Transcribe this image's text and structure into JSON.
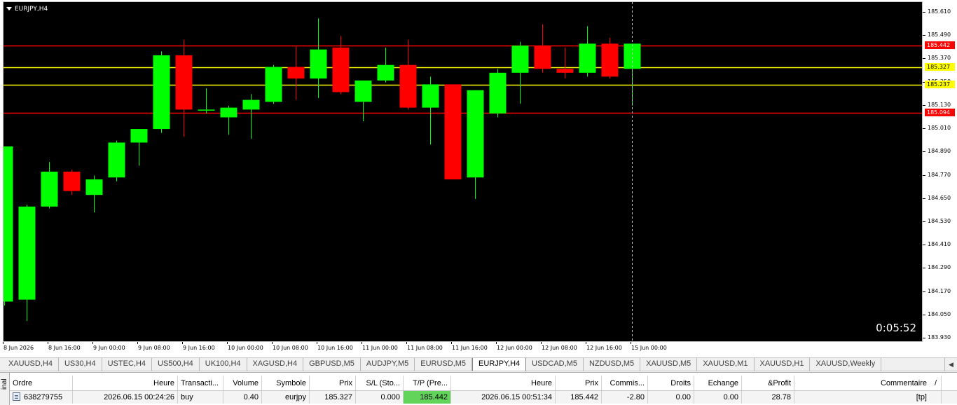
{
  "window": {
    "symbol_title": "EURJPY,H4",
    "countdown": "0:05:52"
  },
  "price_axis": {
    "ticks": [
      "185.610",
      "185.490",
      "185.370",
      "185.250",
      "185.130",
      "185.010",
      "184.890",
      "184.770",
      "184.650",
      "184.530",
      "184.410",
      "184.290",
      "184.170",
      "184.050",
      "183.930"
    ],
    "tick_values": [
      185.61,
      185.49,
      185.37,
      185.25,
      185.13,
      185.01,
      184.89,
      184.77,
      184.65,
      184.53,
      184.41,
      184.29,
      184.17,
      184.05,
      183.93
    ]
  },
  "time_axis": {
    "labels": [
      "8 Jun 2026",
      "8 Jun 16:00",
      "9 Jun 00:00",
      "9 Jun 08:00",
      "9 Jun 16:00",
      "10 Jun 00:00",
      "10 Jun 08:00",
      "10 Jun 16:00",
      "11 Jun 00:00",
      "11 Jun 08:00",
      "11 Jun 16:00",
      "12 Jun 00:00",
      "12 Jun 08:00",
      "12 Jun 16:00",
      "15 Jun 00:00"
    ]
  },
  "colors": {
    "bull": "#00ff00",
    "bear": "#ff0000",
    "tp_line": "#ff0000",
    "entry_line": "#ffff00",
    "background": "#000000"
  },
  "levels": [
    {
      "name": "take-profit-upper",
      "price": 185.442,
      "label": "185.442",
      "color": "#ff0000",
      "text_color": "#ffffff"
    },
    {
      "name": "open-price",
      "price": 185.327,
      "label": "185.327",
      "color": "#ffff00",
      "text_color": "#000000"
    },
    {
      "name": "bid-price",
      "price": 185.237,
      "label": "185.237",
      "color": "#ffff00",
      "text_color": "#000000"
    },
    {
      "name": "lower-level",
      "price": 185.094,
      "label": "185.094",
      "color": "#ff0000",
      "text_color": "#ffffff"
    }
  ],
  "chart_data": {
    "type": "candlestick",
    "symbol": "EURJPY",
    "timeframe": "H4",
    "ylim": [
      183.93,
      185.63
    ],
    "candles": [
      {
        "o": 184.12,
        "h": 184.92,
        "l": 184.1,
        "c": 184.92
      },
      {
        "o": 184.13,
        "h": 184.62,
        "l": 184.02,
        "c": 184.61
      },
      {
        "o": 184.61,
        "h": 184.84,
        "l": 184.6,
        "c": 184.79
      },
      {
        "o": 184.79,
        "h": 184.8,
        "l": 184.67,
        "c": 184.69
      },
      {
        "o": 184.67,
        "h": 184.77,
        "l": 184.58,
        "c": 184.75
      },
      {
        "o": 184.76,
        "h": 184.95,
        "l": 184.74,
        "c": 184.94
      },
      {
        "o": 184.94,
        "h": 185.01,
        "l": 184.82,
        "c": 185.01
      },
      {
        "o": 185.01,
        "h": 185.41,
        "l": 184.99,
        "c": 185.39
      },
      {
        "o": 185.39,
        "h": 185.47,
        "l": 184.97,
        "c": 185.11
      },
      {
        "o": 185.11,
        "h": 185.22,
        "l": 185.09,
        "c": 185.11
      },
      {
        "o": 185.07,
        "h": 185.13,
        "l": 184.98,
        "c": 185.12
      },
      {
        "o": 185.11,
        "h": 185.19,
        "l": 184.96,
        "c": 185.16
      },
      {
        "o": 185.15,
        "h": 185.34,
        "l": 185.14,
        "c": 185.33
      },
      {
        "o": 185.33,
        "h": 185.44,
        "l": 185.16,
        "c": 185.27
      },
      {
        "o": 185.27,
        "h": 185.58,
        "l": 185.17,
        "c": 185.42
      },
      {
        "o": 185.43,
        "h": 185.49,
        "l": 185.19,
        "c": 185.2
      },
      {
        "o": 185.15,
        "h": 185.23,
        "l": 185.05,
        "c": 185.26
      },
      {
        "o": 185.26,
        "h": 185.43,
        "l": 185.25,
        "c": 185.34
      },
      {
        "o": 185.34,
        "h": 185.47,
        "l": 185.11,
        "c": 185.12
      },
      {
        "o": 185.12,
        "h": 185.28,
        "l": 184.93,
        "c": 185.24
      },
      {
        "o": 185.24,
        "h": 185.24,
        "l": 184.75,
        "c": 184.75
      },
      {
        "o": 184.76,
        "h": 185.21,
        "l": 184.65,
        "c": 185.21
      },
      {
        "o": 185.09,
        "h": 185.32,
        "l": 185.07,
        "c": 185.3
      },
      {
        "o": 185.3,
        "h": 185.46,
        "l": 185.14,
        "c": 185.44
      },
      {
        "o": 185.44,
        "h": 185.55,
        "l": 185.3,
        "c": 185.32
      },
      {
        "o": 185.32,
        "h": 185.43,
        "l": 185.27,
        "c": 185.3
      },
      {
        "o": 185.3,
        "h": 185.54,
        "l": 185.28,
        "c": 185.45
      },
      {
        "o": 185.45,
        "h": 185.48,
        "l": 185.27,
        "c": 185.28
      },
      {
        "o": 185.32,
        "h": 185.45,
        "l": 185.13,
        "c": 185.45
      }
    ]
  },
  "symbol_tabs": [
    "XAUUSD,H4",
    "US30,H4",
    "USTEC,H4",
    "US500,H4",
    "UK100,H4",
    "XAGUSD,H4",
    "GBPUSD,M5",
    "AUDJPY,M5",
    "EURUSD,M5",
    "EURJPY,H4",
    "USDCAD,M5",
    "NZDUSD,M5",
    "XAUUSD,M5",
    "XAUUSD,M1",
    "XAUUSD,H1",
    "XAUUSD,Weekly"
  ],
  "active_tab": "EURJPY,H4",
  "terminal": {
    "side_label": "inal",
    "columns": [
      "Ordre",
      "Heure",
      "Transacti...",
      "Volume",
      "Symbole",
      "Prix",
      "S/L (Sto...",
      "T/P (Pre...",
      "Heure",
      "Prix",
      "Commis...",
      "Droits",
      "Echange",
      "&Profit",
      "Commentaire"
    ],
    "sort_mark": "/",
    "rows": [
      [
        "638279755",
        "2026.06.15 00:24:26",
        "buy",
        "0.40",
        "eurjpy",
        "185.327",
        "0.000",
        "185.442",
        "2026.06.15 00:51:34",
        "185.442",
        "-2.80",
        "0.00",
        "0.00",
        "28.78",
        "[tp]"
      ]
    ]
  }
}
